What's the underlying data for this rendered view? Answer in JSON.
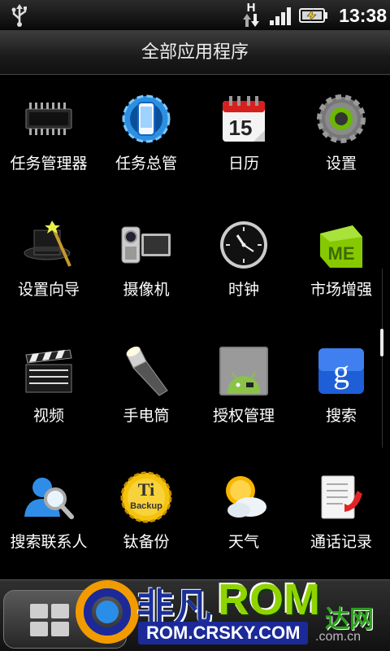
{
  "status_bar": {
    "network_type": "H",
    "time": "13:38",
    "icons": [
      "usb-icon",
      "network-h-icon",
      "signal-icon",
      "battery-charging-icon"
    ]
  },
  "title": "全部应用程序",
  "apps": [
    {
      "label": "任务管理器",
      "icon": "chip-icon"
    },
    {
      "label": "任务总管",
      "icon": "phone-gear-icon"
    },
    {
      "label": "日历",
      "icon": "calendar-icon",
      "day": "15"
    },
    {
      "label": "设置",
      "icon": "gear-icon"
    },
    {
      "label": "设置向导",
      "icon": "magic-hat-icon"
    },
    {
      "label": "摄像机",
      "icon": "camcorder-icon"
    },
    {
      "label": "时钟",
      "icon": "clock-icon"
    },
    {
      "label": "市场增强",
      "icon": "market-me-icon",
      "badge": "ME"
    },
    {
      "label": "视频",
      "icon": "clapperboard-icon"
    },
    {
      "label": "手电筒",
      "icon": "flashlight-icon"
    },
    {
      "label": "授权管理",
      "icon": "android-icon"
    },
    {
      "label": "搜索",
      "icon": "google-search-icon",
      "glyph": "g"
    },
    {
      "label": "搜索联系人",
      "icon": "contact-search-icon"
    },
    {
      "label": "钛备份",
      "icon": "titanium-backup-icon",
      "top_text": "Ti",
      "bottom_text": "Backup"
    },
    {
      "label": "天气",
      "icon": "weather-icon"
    },
    {
      "label": "通话记录",
      "icon": "call-log-icon"
    }
  ],
  "watermark": {
    "brand": "非凡",
    "rom": "ROM",
    "url": "ROM.CRSKY.COM",
    "side": "达网",
    "side_url": ".com.cn"
  },
  "colors": {
    "background": "#000000",
    "title_bar": "#1f1f1f",
    "watermark_blue": "#1b2a98",
    "watermark_green": "#8fd400"
  }
}
